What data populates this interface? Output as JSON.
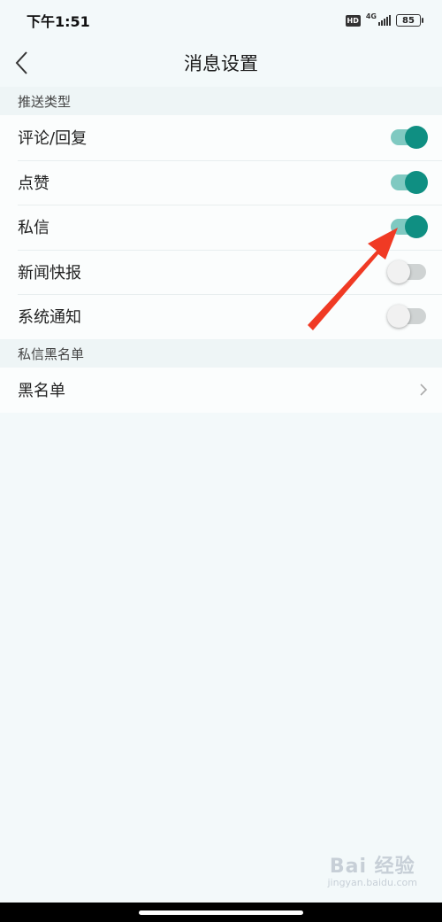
{
  "status_bar": {
    "time": "下午1:51",
    "hd": "HD",
    "network": "4G",
    "battery": "85"
  },
  "nav": {
    "back_icon": "chevron-left-icon",
    "title": "消息设置"
  },
  "push_section": {
    "header": "推送类型",
    "items": [
      {
        "label": "评论/回复",
        "enabled": true
      },
      {
        "label": "点赞",
        "enabled": true
      },
      {
        "label": "私信",
        "enabled": true
      },
      {
        "label": "新闻快报",
        "enabled": false
      },
      {
        "label": "系统通知",
        "enabled": false
      }
    ]
  },
  "blacklist_section": {
    "header": "私信黑名单",
    "items": [
      {
        "label": "黑名单",
        "icon": "chevron-right-icon"
      }
    ]
  },
  "colors": {
    "accent": "#0f8f82",
    "track_on": "#7fc9c1",
    "background": "#f3f9fa",
    "annotation_arrow": "#f03a24"
  },
  "watermark": {
    "logo": "Bai 经验",
    "url": "jingyan.baidu.com"
  }
}
